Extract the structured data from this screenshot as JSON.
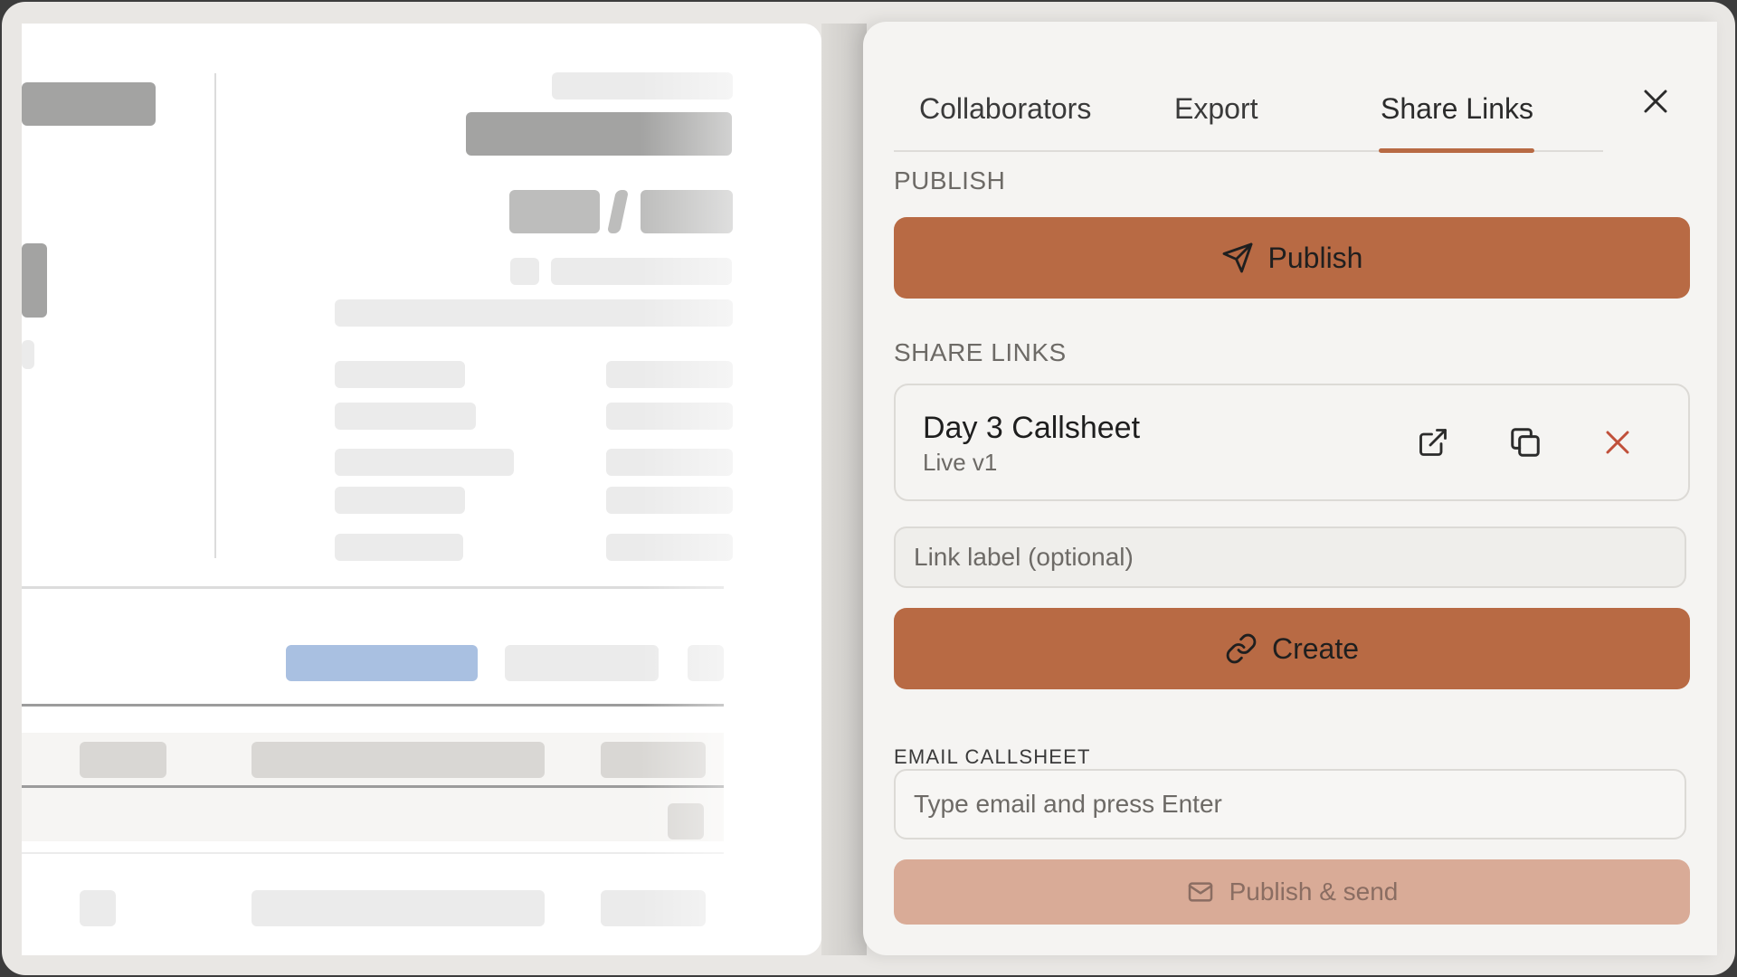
{
  "panel": {
    "tabs": [
      {
        "label": "Collaborators"
      },
      {
        "label": "Export"
      },
      {
        "label": "Share Links"
      }
    ],
    "active_tab": "Share Links",
    "publish": {
      "section_label": "PUBLISH",
      "button_label": "Publish"
    },
    "share_links": {
      "section_label": "SHARE LINKS",
      "items": [
        {
          "title": "Day 3 Callsheet",
          "subtitle": "Live v1"
        }
      ],
      "label_placeholder": "Link label (optional)",
      "create_label": "Create"
    },
    "email": {
      "section_label": "EMAIL CALLSHEET",
      "placeholder": "Type email and press Enter",
      "send_label": "Publish & send"
    }
  },
  "colors": {
    "accent": "#b86a44",
    "accent_disabled": "#d9ab97",
    "danger": "#c0503a",
    "panel_bg": "#f5f4f2"
  },
  "icons": {
    "publish": "send-icon",
    "open_link": "external-link-icon",
    "copy_link": "copy-icon",
    "delete_link": "close-icon",
    "create": "link-icon",
    "send": "mail-icon"
  }
}
